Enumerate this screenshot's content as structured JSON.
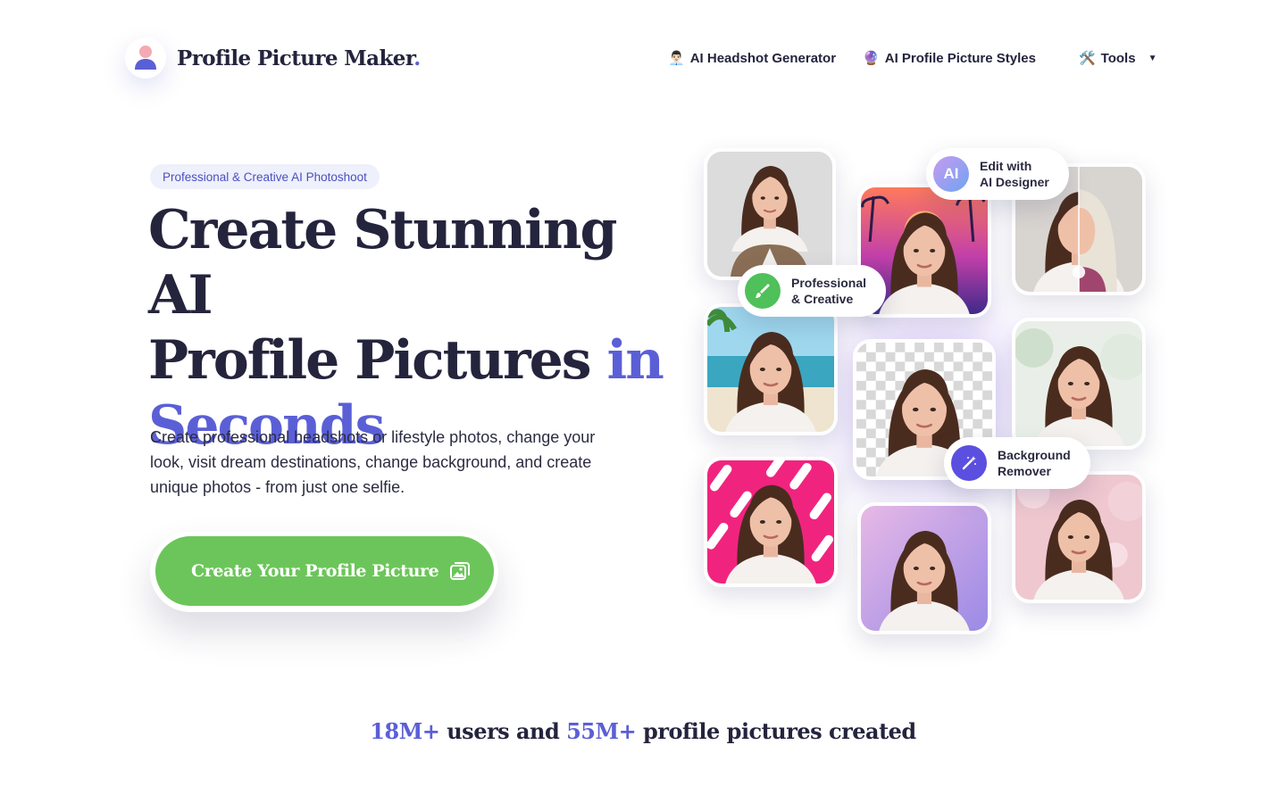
{
  "brand": {
    "name": "Profile Picture Maker",
    "dot": "."
  },
  "nav": {
    "items": [
      {
        "emoji": "👨🏻‍💼",
        "label": "AI Headshot Generator"
      },
      {
        "emoji": "🔮",
        "label": "AI Profile Picture Styles"
      }
    ],
    "tools": {
      "emoji": "🛠️",
      "label": "Tools",
      "caret": "▼"
    }
  },
  "hero": {
    "badge": "Professional & Creative AI Photoshoot",
    "headline": {
      "line1": "Create Stunning AI",
      "line2": "Profile Pictures",
      "accent": "in",
      "line3": "Seconds"
    },
    "subtitle": "Create professional headshots or lifestyle photos, change your look, visit dream destinations, change background, and create unique photos - from just one selfie.",
    "cta": "Create Your Profile Picture"
  },
  "collage": {
    "pills": {
      "designer": {
        "icon": "AI",
        "line1": "Edit with",
        "line2": "AI Designer",
        "color": "#8f7ee8"
      },
      "professional": {
        "line1": "Professional",
        "line2": "& Creative",
        "color": "#4fc05a"
      },
      "background": {
        "line1": "Background",
        "line2": "Remover",
        "color": "#5b4fe0"
      }
    }
  },
  "stats": {
    "users": "18M+",
    "text1": " users and ",
    "pictures": "55M+",
    "text2": " profile pictures created"
  },
  "colors": {
    "accent": "#5b5fd6",
    "cta": "#6cc55a",
    "text": "#25243d",
    "badge_bg": "#eef0fb"
  }
}
